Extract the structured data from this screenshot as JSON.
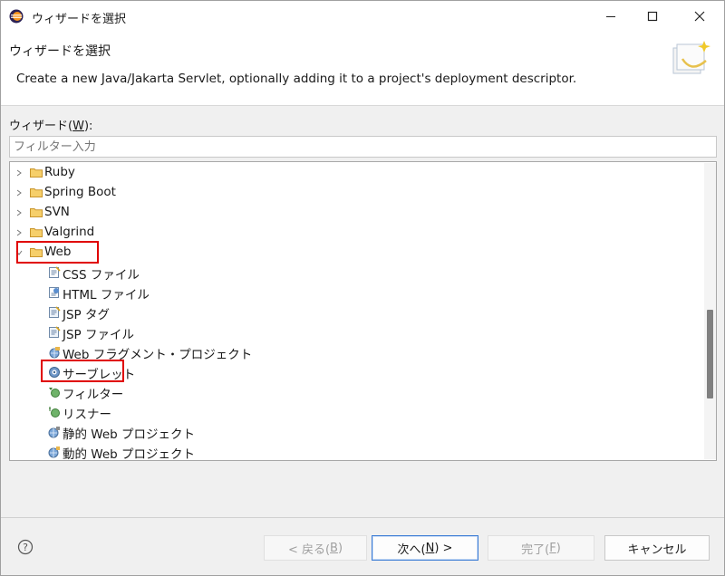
{
  "window": {
    "title": "ウィザードを選択"
  },
  "header": {
    "title": "ウィザードを選択",
    "description": "Create a new Java/Jakarta Servlet, optionally adding it to a project's deployment descriptor."
  },
  "wizards": {
    "label": "ウィザード(",
    "mnemonic": "W",
    "label_end": "):"
  },
  "filter": {
    "placeholder": "フィルター入力"
  },
  "tree": {
    "folders": [
      {
        "label": "Ruby",
        "expanded": false
      },
      {
        "label": "Spring Boot",
        "expanded": false
      },
      {
        "label": "SVN",
        "expanded": false
      },
      {
        "label": "Valgrind",
        "expanded": false
      },
      {
        "label": "Web",
        "expanded": true
      }
    ],
    "web_children": [
      {
        "label": "CSS ファイル",
        "icon": "css-file-icon"
      },
      {
        "label": "HTML ファイル",
        "icon": "html-file-icon"
      },
      {
        "label": "JSP タグ",
        "icon": "jsp-tag-icon"
      },
      {
        "label": "JSP ファイル",
        "icon": "jsp-file-icon"
      },
      {
        "label": "Web フラグメント・プロジェクト",
        "icon": "web-fragment-project-icon"
      },
      {
        "label": "サーブレット",
        "icon": "servlet-icon",
        "highlighted": true
      },
      {
        "label": "フィルター",
        "icon": "filter-icon"
      },
      {
        "label": "リスナー",
        "icon": "listener-icon"
      },
      {
        "label": "静的 Web プロジェクト",
        "icon": "static-web-project-icon"
      },
      {
        "label": "動的 Web プロジェクト",
        "icon": "dynamic-web-project-icon"
      }
    ]
  },
  "buttons": {
    "back": {
      "label": "< 戻る(",
      "mnemonic": "B",
      "end": ")",
      "enabled": false
    },
    "next": {
      "label": "次へ(",
      "mnemonic": "N",
      "end": ") >",
      "enabled": true
    },
    "finish": {
      "label": "完了(",
      "mnemonic": "F",
      "end": ")",
      "enabled": false
    },
    "cancel": {
      "label": "キャンセル",
      "enabled": true
    }
  },
  "colors": {
    "highlight_box": "#e00000",
    "accent": "#3a7bd5",
    "folder": "#e8b54a"
  }
}
